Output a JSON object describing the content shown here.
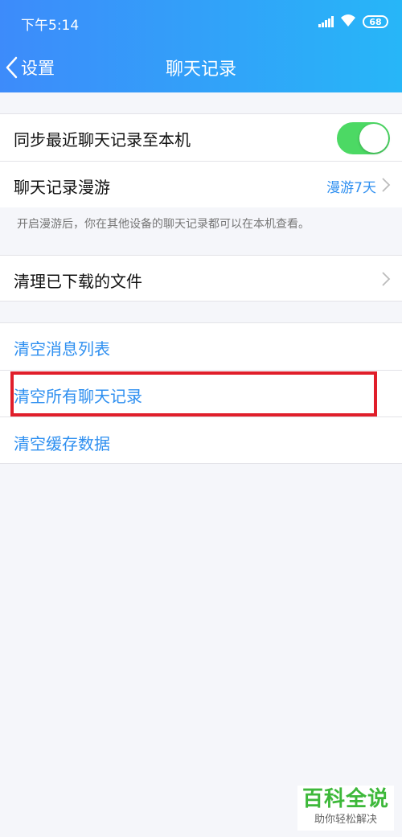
{
  "status_bar": {
    "time": "下午5:14",
    "battery": "68",
    "icons": [
      "signal-icon",
      "wifi-icon",
      "battery-icon"
    ]
  },
  "nav": {
    "back_label": "设置",
    "title": "聊天记录"
  },
  "settings": {
    "sync_label": "同步最近聊天记录至本机",
    "sync_enabled": true,
    "roaming_label": "聊天记录漫游",
    "roaming_value": "漫游7天",
    "roaming_hint": "开启漫游后，你在其他设备的聊天记录都可以在本机查看。",
    "clear_downloads_label": "清理已下载的文件"
  },
  "actions": {
    "clear_message_list": "清空消息列表",
    "clear_all_chat": "清空所有聊天记录",
    "clear_cache": "清空缓存数据"
  },
  "watermark": {
    "main": "百科全说",
    "sub": "助你轻松解决"
  },
  "colors": {
    "header_start": "#3d8bfa",
    "header_end": "#27b6f8",
    "toggle_on": "#4cd964",
    "link_blue": "#2e8ff0",
    "highlight_red": "#e01e2a",
    "watermark_green": "#3db83a"
  }
}
